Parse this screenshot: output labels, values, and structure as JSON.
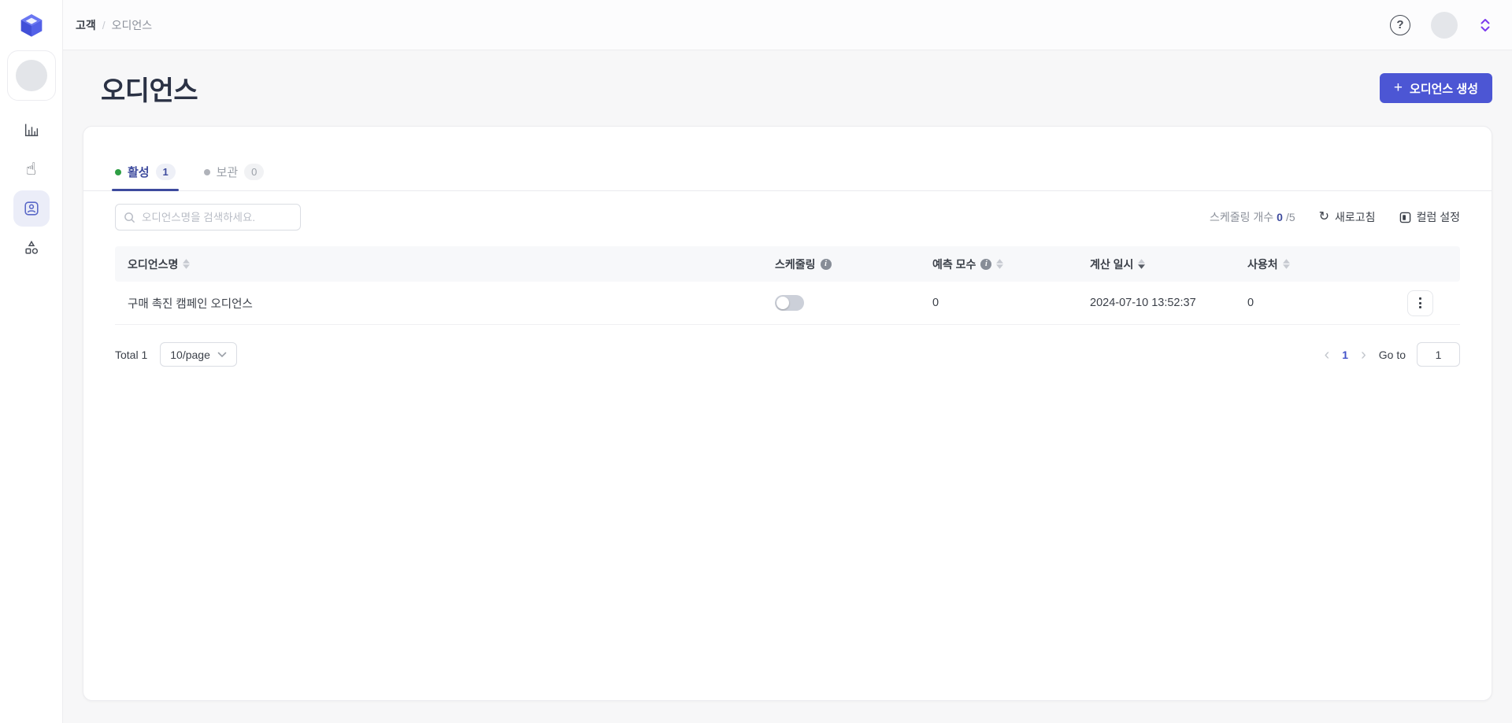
{
  "sidebar": {
    "icons": [
      {
        "name": "analytics"
      },
      {
        "name": "actions"
      },
      {
        "name": "audience",
        "active": true
      },
      {
        "name": "journey"
      }
    ]
  },
  "breadcrumb": {
    "item1": "고객",
    "separator": "/",
    "item2": "오디언스"
  },
  "page": {
    "title": "오디언스",
    "create_button_label": "오디언스 생성",
    "plus": "+"
  },
  "tabs": {
    "active": {
      "label": "활성",
      "count": "1"
    },
    "archived": {
      "label": "보관",
      "count": "0"
    }
  },
  "toolbar": {
    "search_placeholder": "오디언스명을 검색하세요.",
    "scheduling_count_label": "스케줄링 개수",
    "scheduling_used": "0",
    "scheduling_suffix": "/5",
    "refresh_label": "새로고침",
    "refresh_glyph": "↻",
    "column_settings_label": "컬럼 설정"
  },
  "table": {
    "columns": {
      "name": "오디언스명",
      "scheduling": "스케줄링",
      "predicted": "예측 모수",
      "calculated": "계산 일시",
      "usage": "사용처"
    },
    "sort_state": {
      "calculated": "desc"
    },
    "row": {
      "name": "구매 촉진 캠페인 오디언스",
      "scheduling_enabled": false,
      "predicted": "0",
      "calculated": "2024-07-10 13:52:37",
      "usage": "0"
    }
  },
  "pagination": {
    "total": "Total 1",
    "page_size": "10/page",
    "prev": "‹",
    "next": "›",
    "current": "1",
    "goto_label": "Go to",
    "goto_value": "1"
  },
  "topbar": {
    "help_glyph": "?"
  },
  "colors": {
    "primary": "#4c56d4",
    "active_tab": "#3e4b9e",
    "green_dot": "#2e9e44",
    "gray_dot": "#b0b3ba",
    "purple_accent": "#7c3aed"
  }
}
